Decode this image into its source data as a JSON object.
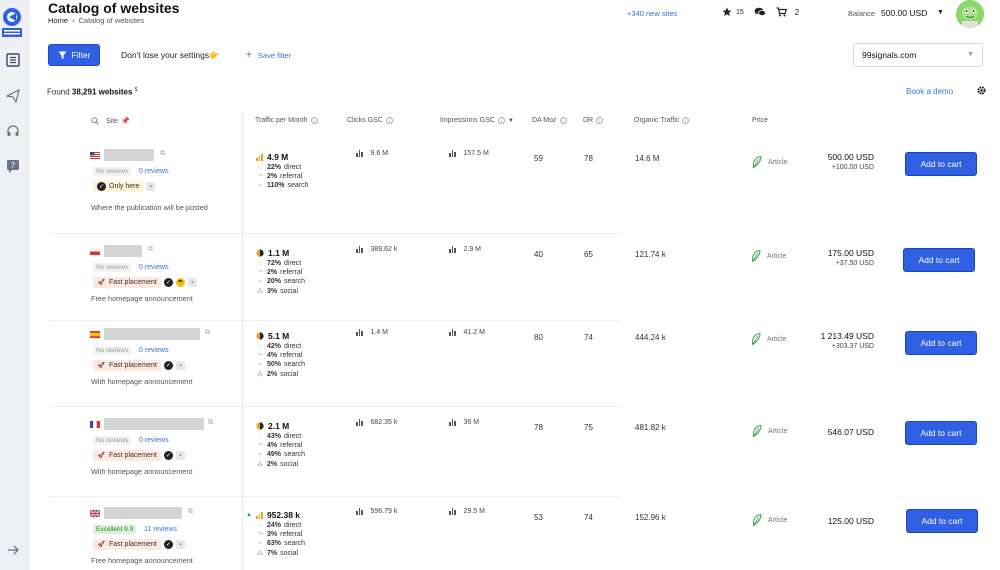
{
  "header": {
    "title": "Catalog of websites",
    "breadcrumb_home": "Home",
    "breadcrumb_sep": "›",
    "breadcrumb_current": "Catalog of websites",
    "new_sites": "+340 new sites",
    "favorites_count": "15",
    "cart_count": "2",
    "balance_label": "Balance",
    "balance_value": "500.00 USD"
  },
  "toolbar": {
    "filter_label": "Filter",
    "dont_lose": "Don't lose your settings👉",
    "save_filter": "Save filter",
    "site_select_value": "99signals.com"
  },
  "summary": {
    "found_prefix": "Found",
    "found_count": "38,291 websites",
    "found_suffix": "$",
    "book_demo": "Book a demo"
  },
  "columns": {
    "site": "Site",
    "traffic": "Traffic per Month",
    "clicks": "Clicks GSC",
    "impressions": "Impressions GSC",
    "da": "DA Moz",
    "dr": "DR",
    "organic": "Organic Traffic",
    "price": "Price"
  },
  "rows": [
    {
      "review_badge": "No reviews",
      "reviews_link": "0 reviews",
      "tags": [
        "Only here"
      ],
      "description": "Where the publication will be posted",
      "traffic_total": "4.9 M",
      "direct_pct": "22%",
      "referral_pct": "2%",
      "search_pct": "110%",
      "clicks": "9.6 M",
      "impressions": "157.5 M",
      "da": "59",
      "dr": "78",
      "organic": "14.6 M",
      "price_type": "Article",
      "price": "500.00 USD",
      "price_extra": "+100.00 USD",
      "cart_label": "Add to cart"
    },
    {
      "review_badge": "No reviews",
      "reviews_link": "0 reviews",
      "tags": [
        "Fast placement"
      ],
      "description": "Free homepage announcement",
      "traffic_total": "1.1 M",
      "direct_pct": "72%",
      "referral_pct": "2%",
      "search_pct": "20%",
      "social_pct": "3%",
      "clicks": "389.62 k",
      "impressions": "2.9 M",
      "da": "40",
      "dr": "65",
      "organic": "121.74 k",
      "price_type": "Article",
      "price": "175.00 USD",
      "price_extra": "+37.50 USD",
      "cart_label": "Add to cart"
    },
    {
      "review_badge": "No reviews",
      "reviews_link": "0 reviews",
      "tags": [
        "Fast placement"
      ],
      "description": "With homepage announcement",
      "traffic_total": "5.1 M",
      "direct_pct": "42%",
      "referral_pct": "4%",
      "search_pct": "50%",
      "social_pct": "2%",
      "clicks": "1.4 M",
      "impressions": "41.2 M",
      "da": "80",
      "dr": "74",
      "organic": "444.24 k",
      "price_type": "Article",
      "price": "1 213.49 USD",
      "price_extra": "+303.37 USD",
      "cart_label": "Add to cart"
    },
    {
      "review_badge": "No reviews",
      "reviews_link": "0 reviews",
      "tags": [
        "Fast placement"
      ],
      "description": "With homepage announcement",
      "traffic_total": "2.1 M",
      "direct_pct": "43%",
      "referral_pct": "4%",
      "search_pct": "49%",
      "social_pct": "2%",
      "clicks": "682.35 k",
      "impressions": "36 M",
      "da": "78",
      "dr": "75",
      "organic": "481.82 k",
      "price_type": "Article",
      "price": "546.07 USD",
      "cart_label": "Add to cart"
    },
    {
      "review_badge": "Excellent 9.9",
      "reviews_link": "11 reviews",
      "tags": [
        "Fast placement"
      ],
      "description": "Free homepage announcement",
      "traffic_total": "952.38 k",
      "direct_pct": "24%",
      "referral_pct": "3%",
      "search_pct": "63%",
      "social_pct": "7%",
      "clicks": "596.79 k",
      "impressions": "29.5 M",
      "da": "53",
      "dr": "74",
      "organic": "152.96 k",
      "price_type": "Article",
      "price": "125.00 USD",
      "cart_label": "Add to cart"
    }
  ],
  "labels": {
    "direct": "direct",
    "referral": "referral",
    "search": "search",
    "social": "social"
  },
  "colors": {
    "accent": "#2f5fe3",
    "link": "#3b6fe0",
    "rail": "#eef0f3"
  }
}
